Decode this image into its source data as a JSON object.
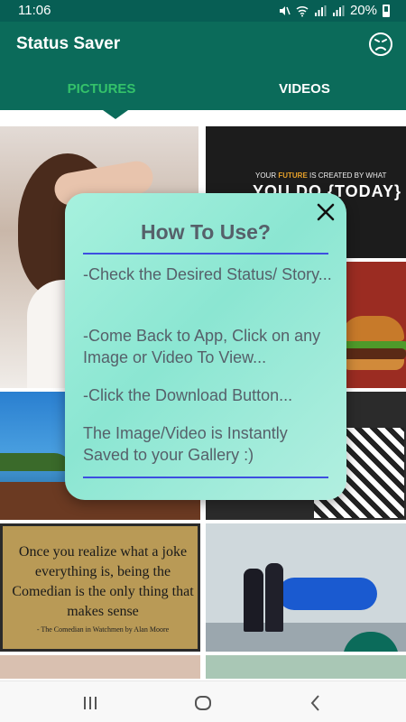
{
  "status_bar": {
    "time": "11:06",
    "battery": "20%",
    "icons": [
      "mute-icon",
      "wifi-icon",
      "signal-icon",
      "signal-icon",
      "battery-icon"
    ]
  },
  "app_bar": {
    "title": "Status Saver",
    "action_icon": "sad-face-icon",
    "tabs": [
      {
        "label": "PICTURES",
        "active": true
      },
      {
        "label": "VIDEOS",
        "active": false
      }
    ]
  },
  "colors": {
    "primary": "#0b6b5a",
    "status_bar": "#075e54",
    "active_tab": "#34c26a",
    "dialog_start": "#a7f1de",
    "dialog_text": "#56606a",
    "divider": "#3d4ee0"
  },
  "grid": {
    "tiles": [
      {
        "caption_top": "YOUR FUTURE IS CREATED BY WHAT",
        "caption_highlight": "FUTURE",
        "caption_main": "YOU DO {TODAY}"
      },
      {
        "quote": "Once you realize what a joke everything is, being the Comedian is the only thing that makes sense",
        "credit": "- The Comedian in Watchmen by Alan Moore"
      }
    ]
  },
  "dialog": {
    "title": "How To Use?",
    "steps": [
      "-Check the Desired Status/ Story...",
      "-Come Back to App, Click on any Image or Video To View...",
      "-Click the Download Button...",
      "The Image/Video is Instantly Saved to your Gallery :)"
    ],
    "close_icon": "close-icon"
  },
  "nav_bar": {
    "buttons": [
      "recent-apps-icon",
      "home-icon",
      "back-icon"
    ]
  }
}
